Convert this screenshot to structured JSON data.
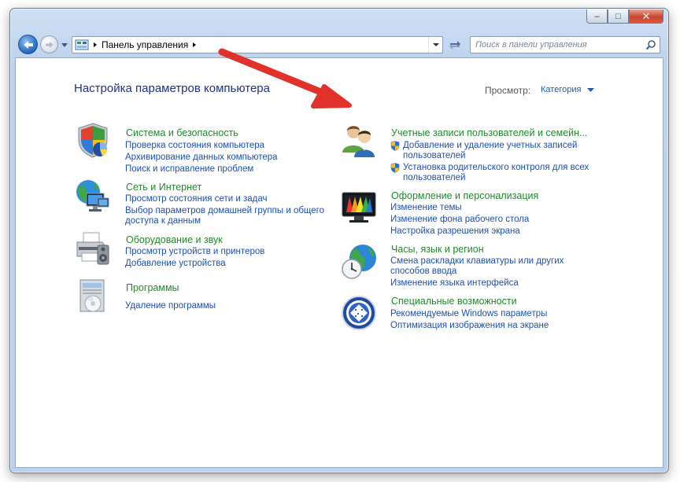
{
  "window": {
    "minimize_label": "–",
    "maximize_label": "□",
    "close_label": "✕"
  },
  "navbar": {
    "breadcrumb": "Панель управления",
    "search_placeholder": "Поиск в панели управления"
  },
  "header": {
    "title": "Настройка параметров компьютера",
    "view_label": "Просмотр:",
    "view_value": "Категория"
  },
  "left_categories": [
    {
      "title": "Система и безопасность",
      "links": [
        "Проверка состояния компьютера",
        "Архивирование данных компьютера",
        "Поиск и исправление проблем"
      ]
    },
    {
      "title": "Сеть и Интернет",
      "links": [
        "Просмотр состояния сети и задач",
        "Выбор параметров домашней группы и общего",
        "доступа к данным"
      ]
    },
    {
      "title": "Оборудование и звук",
      "links": [
        "Просмотр устройств и принтеров",
        "Добавление устройства"
      ]
    },
    {
      "title": "Программы",
      "links": [
        "Удаление программы"
      ]
    }
  ],
  "right_categories": [
    {
      "title": "Учетные записи пользователей и семейн...",
      "links": [
        "Добавление и удаление учетных записей",
        "пользователей",
        "Установка родительского контроля для всех",
        "пользователей"
      ]
    },
    {
      "title": "Оформление и персонализация",
      "links": [
        "Изменение темы",
        "Изменение фона рабочего стола",
        "Настройка разрешения экрана"
      ]
    },
    {
      "title": "Часы, язык и регион",
      "links": [
        "Смена раскладки клавиатуры или других",
        "способов ввода",
        "Изменение языка интерфейса"
      ]
    },
    {
      "title": "Специальные возможности",
      "links": [
        "Рекомендуемые Windows параметры",
        "Оптимизация изображения на экране"
      ]
    }
  ],
  "colors": {
    "category_title": "#1f8a2a",
    "link": "#1c4fb6",
    "page_title": "#1e3287",
    "annotation_arrow": "#e0322a"
  }
}
